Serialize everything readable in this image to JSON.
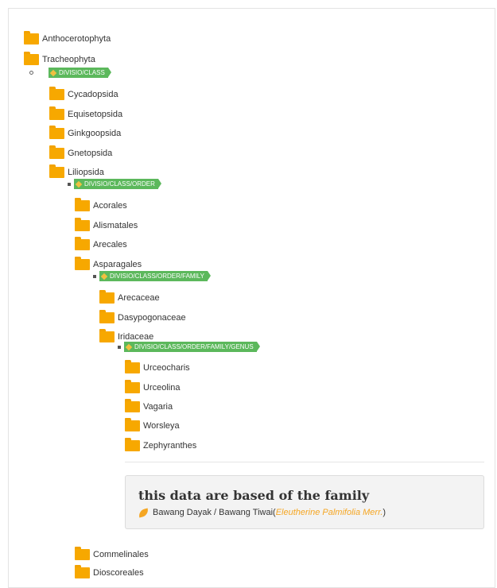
{
  "tree": {
    "level0": [
      {
        "label": "Anthocerotophyta"
      },
      {
        "label": "Tracheophyta"
      }
    ],
    "badge_class": "DIVISIO/CLASS",
    "classes": [
      {
        "label": "Cycadopsida"
      },
      {
        "label": "Equisetopsida"
      },
      {
        "label": "Ginkgoopsida"
      },
      {
        "label": "Gnetopsida"
      },
      {
        "label": "Liliopsida"
      }
    ],
    "badge_order": "DIVISIO/CLASS/ORDER",
    "orders": [
      {
        "label": "Acorales"
      },
      {
        "label": "Alismatales"
      },
      {
        "label": "Arecales"
      },
      {
        "label": "Asparagales"
      }
    ],
    "badge_family": "DIVISIO/CLASS/ORDER/FAMILY",
    "families": [
      {
        "label": "Arecaceae"
      },
      {
        "label": "Dasypogonaceae"
      },
      {
        "label": "Iridaceae"
      }
    ],
    "badge_genus": "DIVISIO/CLASS/ORDER/FAMILY/GENUS",
    "genera": [
      {
        "label": "Urceocharis"
      },
      {
        "label": "Urceolina"
      },
      {
        "label": "Vagaria"
      },
      {
        "label": "Worsleya"
      },
      {
        "label": "Zephyranthes"
      }
    ],
    "more_orders": [
      {
        "label": "Commelinales"
      },
      {
        "label": "Dioscoreales"
      }
    ]
  },
  "info": {
    "title": "this data are based of the family",
    "common_name": "Bawang Dayak / Bawang Tiwai(",
    "scientific_name": "Eleutherine Palmifolia Merr.",
    "closing": ")"
  },
  "colors": {
    "folder": "#f7a800",
    "badge": "#5cb85c",
    "accent": "#f5a623"
  }
}
